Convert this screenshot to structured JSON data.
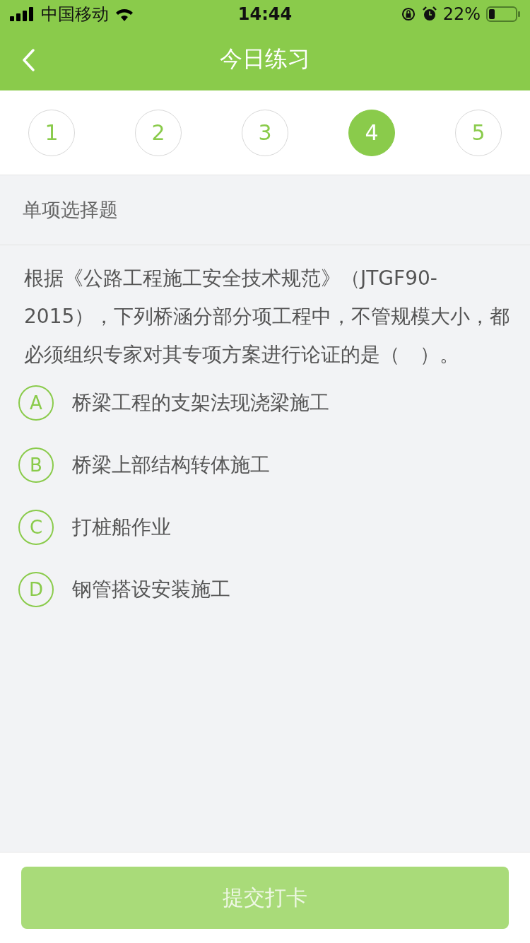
{
  "status_bar": {
    "carrier": "中国移动",
    "time": "14:44",
    "battery": "22%"
  },
  "nav": {
    "title": "今日练习"
  },
  "questions": [
    {
      "label": "1",
      "selected": false
    },
    {
      "label": "2",
      "selected": false
    },
    {
      "label": "3",
      "selected": false
    },
    {
      "label": "4",
      "selected": true
    },
    {
      "label": "5",
      "selected": false
    }
  ],
  "question_type": "单项选择题",
  "question": "根据《公路工程施工安全技术规范》（JTGF90-2015），下列桥涵分部分项工程中，不管规模大小，都必须组织专家对其专项方案进行论证的是（　）。",
  "options": [
    {
      "letter": "A",
      "text": "桥梁工程的支架法现浇梁施工",
      "selected": false
    },
    {
      "letter": "B",
      "text": "桥梁上部结构转体施工",
      "selected": false
    },
    {
      "letter": "C",
      "text": "打桩船作业",
      "selected": false
    },
    {
      "letter": "D",
      "text": "钢管搭设安装施工",
      "selected": false
    }
  ],
  "submit": {
    "label": "提交打卡",
    "disabled": true
  }
}
